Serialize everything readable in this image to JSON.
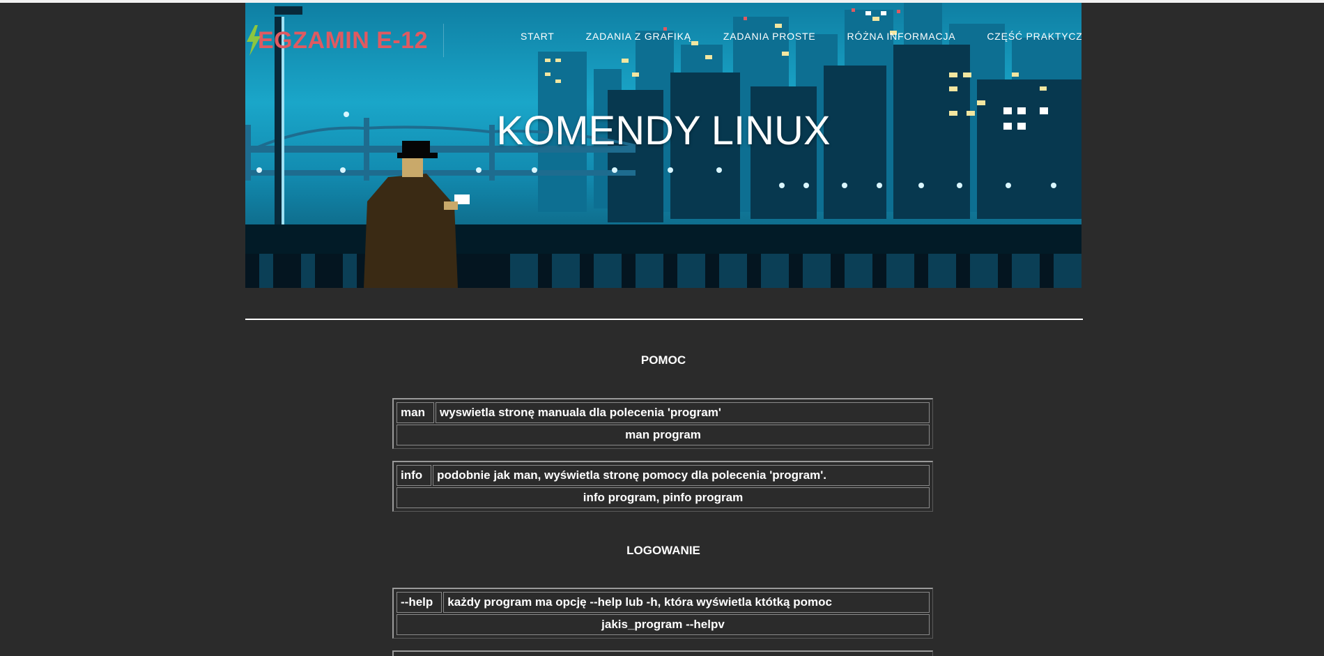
{
  "site": {
    "logo_text": "EGZAMIN E-12"
  },
  "nav": {
    "items": [
      {
        "label": "START"
      },
      {
        "label": "ZADANIA Z GRAFIKĄ"
      },
      {
        "label": "ZADANIA PROSTE"
      },
      {
        "label": "RÓŻNA INFORMACJA"
      },
      {
        "label": "CZĘŚĆ PRAKTYCZNA"
      }
    ]
  },
  "hero": {
    "title": "KOMENDY LINUX"
  },
  "sections": [
    {
      "title": "POMOC",
      "commands": [
        {
          "name": "man",
          "description": "wyswietla stronę manuala dla polecenia 'program'",
          "example": "man program"
        },
        {
          "name": "info",
          "description": "podobnie jak man, wyświetla stronę pomocy dla polecenia 'program'.",
          "example": "info program, pinfo program"
        }
      ]
    },
    {
      "title": "LOGOWANIE",
      "commands": [
        {
          "name": "--help",
          "description": "każdy program ma opcję --help lub -h, która wyświetla któtką pomoc",
          "example": "jakis_program --helpv"
        }
      ]
    }
  ],
  "colors": {
    "page_bg": "#2b2b2b",
    "logo": "#e05a61",
    "bolt": "#8cc63f"
  }
}
